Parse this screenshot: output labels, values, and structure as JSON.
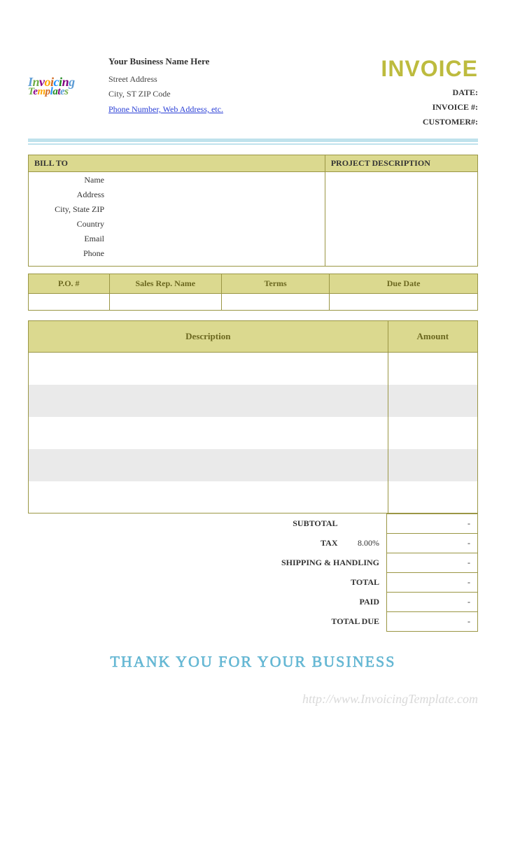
{
  "logo": {
    "line1": "Invoicing",
    "line2": "Templates"
  },
  "business": {
    "name": "Your Business Name Here",
    "street": "Street Address",
    "city_line": "City, ST  ZIP Code",
    "contact_link": "Phone Number, Web Address, etc."
  },
  "invoice": {
    "title": "INVOICE",
    "date_label": "DATE:",
    "number_label": "INVOICE #:",
    "customer_label": "CUSTOMER#:"
  },
  "bill_to": {
    "header": "BILL TO",
    "fields": {
      "name": "Name",
      "address": "Address",
      "citystatezip": "City, State ZIP",
      "country": "Country",
      "email": "Email",
      "phone": "Phone"
    }
  },
  "project": {
    "header": "PROJECT DESCRIPTION"
  },
  "po_row": {
    "po": "P.O. #",
    "rep": "Sales Rep. Name",
    "terms": "Terms",
    "due": "Due Date"
  },
  "items": {
    "desc_header": "Description",
    "amount_header": "Amount"
  },
  "totals": {
    "subtotal_label": "SUBTOTAL",
    "tax_label": "TAX",
    "tax_rate": "8.00%",
    "shipping_label": "SHIPPING & HANDLING",
    "total_label": "TOTAL",
    "paid_label": "PAID",
    "due_label": "TOTAL DUE",
    "dash": "-"
  },
  "thank_you": "THANK YOU FOR YOUR BUSINESS",
  "watermark": "http://www.InvoicingTemplate.com"
}
